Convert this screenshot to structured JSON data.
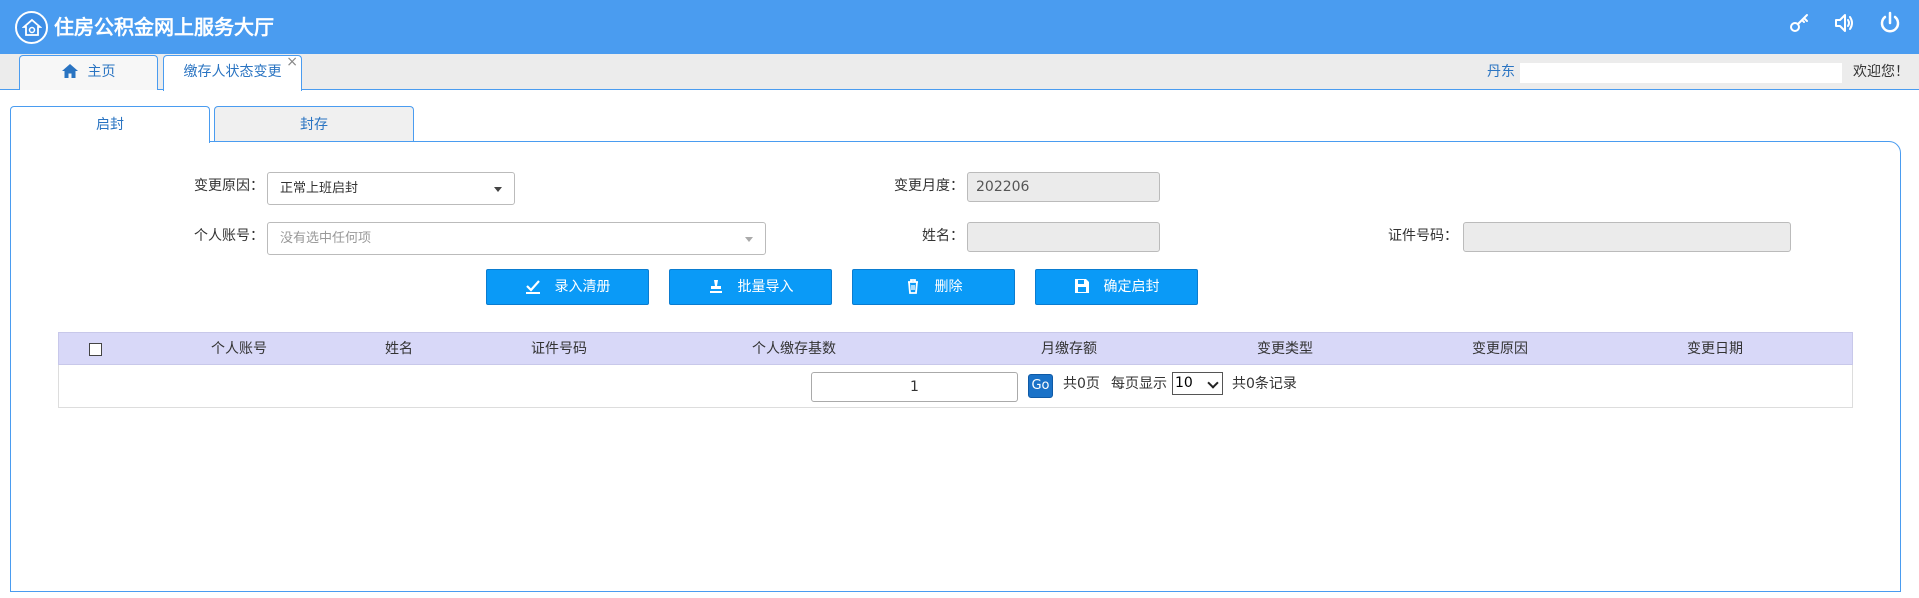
{
  "header": {
    "title": "住房公积金网上服务大厅",
    "icons": [
      "key-icon",
      "speaker-icon",
      "power-icon"
    ]
  },
  "tabs": {
    "home_label": "主页",
    "active_label": "缴存人状态变更",
    "close_glyph": "×"
  },
  "user": {
    "name": "丹东",
    "welcome": "欢迎您！"
  },
  "subtabs": [
    "启封",
    "封存"
  ],
  "form": {
    "reason_label": "变更原因：",
    "reason_value": "正常上班启封",
    "month_label": "变更月度：",
    "month_value": "202206",
    "account_label": "个人账号：",
    "account_placeholder": "没有选中任何项",
    "name_label": "姓名：",
    "name_value": "",
    "id_label": "证件号码：",
    "id_value": ""
  },
  "buttons": {
    "enter_list": "录入清册",
    "batch_import": "批量导入",
    "delete": "删除",
    "confirm": "确定启封"
  },
  "table": {
    "columns": [
      "个人账号",
      "姓名",
      "证件号码",
      "个人缴存基数",
      "月缴存额",
      "变更类型",
      "变更原因",
      "变更日期"
    ],
    "rows": []
  },
  "pagination": {
    "page": "1",
    "go": "Go",
    "total_pages": "共0页",
    "per_page_label": "每页显示",
    "per_page": "10",
    "total_records": "共0条记录"
  },
  "colors": {
    "header": "#4a9cf0",
    "button": "#0a9af7",
    "table_header": "#d8d8f8"
  }
}
